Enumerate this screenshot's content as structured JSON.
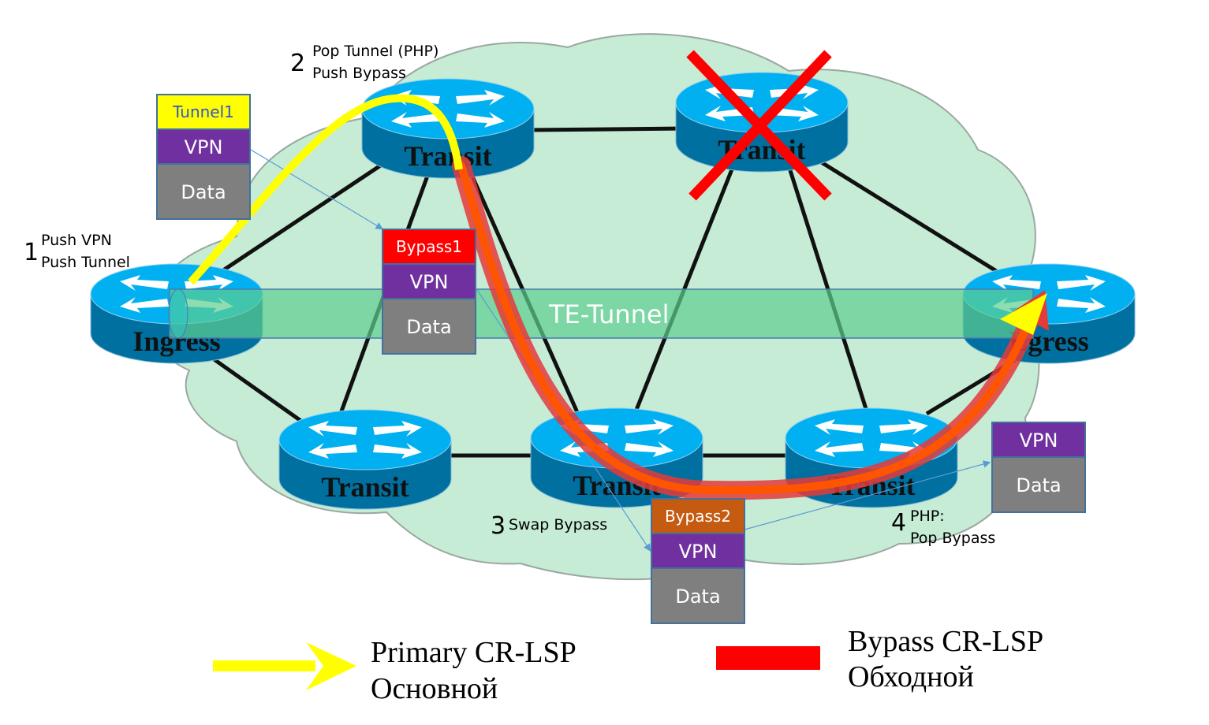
{
  "routers": [
    {
      "id": "ingress",
      "label": "Ingress"
    },
    {
      "id": "transit-top-left",
      "label": "Transit"
    },
    {
      "id": "transit-top-right",
      "label": "Transit",
      "failed": true
    },
    {
      "id": "egress",
      "label": "Egress"
    },
    {
      "id": "transit-bottom-left",
      "label": "Transit"
    },
    {
      "id": "transit-bottom-mid",
      "label": "Transit"
    },
    {
      "id": "transit-bottom-right",
      "label": "Transit"
    }
  ],
  "te_tunnel_label": "TE-Tunnel",
  "steps": [
    {
      "num": "1",
      "line1": "Push VPN",
      "line2": "Push Tunnel"
    },
    {
      "num": "2",
      "line1": "Pop Tunnel (PHP)",
      "line2": "Push Bypass"
    },
    {
      "num": "3",
      "line1": "Swap Bypass",
      "line2": ""
    },
    {
      "num": "4",
      "line1": "PHP:",
      "line2": "Pop Bypass"
    }
  ],
  "stacks": {
    "s1": [
      {
        "label": "Tunnel1",
        "color": "#ffff00",
        "text": "#3355cc"
      },
      {
        "label": "VPN",
        "color": "#7030a0",
        "text": "#ffffff"
      },
      {
        "label": "Data",
        "color": "#7f7f7f",
        "text": "#ffffff"
      }
    ],
    "s2": [
      {
        "label": "Bypass1",
        "color": "#ff0000",
        "text": "#ffffff"
      },
      {
        "label": "VPN",
        "color": "#7030a0",
        "text": "#ffffff"
      },
      {
        "label": "Data",
        "color": "#7f7f7f",
        "text": "#ffffff"
      }
    ],
    "s3": [
      {
        "label": "Bypass2",
        "color": "#c55a11",
        "text": "#ffffff"
      },
      {
        "label": "VPN",
        "color": "#7030a0",
        "text": "#ffffff"
      },
      {
        "label": "Data",
        "color": "#7f7f7f",
        "text": "#ffffff"
      }
    ],
    "s4": [
      {
        "label": "VPN",
        "color": "#7030a0",
        "text": "#ffffff"
      },
      {
        "label": "Data",
        "color": "#7f7f7f",
        "text": "#ffffff"
      }
    ]
  },
  "legend": {
    "primary_line1": "Primary CR-LSP",
    "primary_line2": "Основной",
    "bypass_line1": "Bypass CR-LSP",
    "bypass_line2": "Обходной"
  },
  "colors": {
    "primary": "#ffff00",
    "bypass": "#ff0000",
    "router_top": "#00b0f0",
    "router_side": "#0070a0",
    "cloud": "#c6ecd5",
    "tunnel": "#6fd39a"
  }
}
